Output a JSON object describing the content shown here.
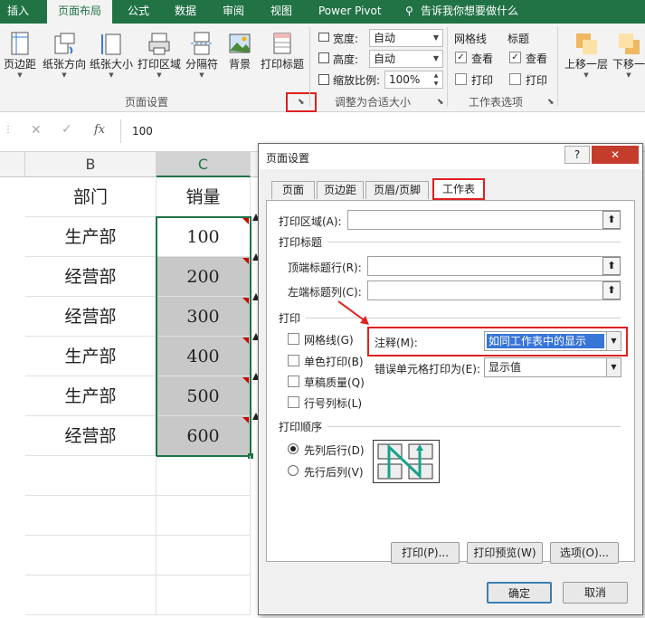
{
  "ribbon_tabs": [
    "插入",
    "页面布局",
    "公式",
    "数据",
    "审阅",
    "视图",
    "Power Pivot",
    "告诉我你想要做什么"
  ],
  "page_setup_group": {
    "buttons": [
      "页边距",
      "纸张方向",
      "纸张大小",
      "打印区域",
      "分隔符",
      "背景",
      "打印标题"
    ],
    "name": "页面设置"
  },
  "scale_group": {
    "width_label": "宽度:",
    "width_value": "自动",
    "height_label": "高度:",
    "height_value": "自动",
    "scale_label": "缩放比例:",
    "scale_value": "100%",
    "name": "调整为合适大小"
  },
  "sheet_options_group": {
    "gridlines": "网格线",
    "headings": "标题",
    "view": "查看",
    "print": "打印",
    "name": "工作表选项"
  },
  "arrange_group": {
    "bring_forward": "上移一层",
    "send_backward": "下移一"
  },
  "formula_bar": {
    "value": "100",
    "fx": "fx"
  },
  "columns": [
    "B",
    "C"
  ],
  "header_row": {
    "dept": "部门",
    "sales": "销量"
  },
  "rows": [
    {
      "dept": "生产部",
      "sales": "100"
    },
    {
      "dept": "经营部",
      "sales": "200"
    },
    {
      "dept": "经营部",
      "sales": "300"
    },
    {
      "dept": "生产部",
      "sales": "400"
    },
    {
      "dept": "生产部",
      "sales": "500"
    },
    {
      "dept": "经营部",
      "sales": "600"
    }
  ],
  "dialog": {
    "title": "页面设置",
    "tabs": [
      "页面",
      "页边距",
      "页眉/页脚",
      "工作表"
    ],
    "print_area": "打印区域(A):",
    "print_titles": "打印标题",
    "rows_repeat": "顶端标题行(R):",
    "cols_repeat": "左端标题列(C):",
    "print_section": "打印",
    "checkboxes": [
      "网格线(G)",
      "单色打印(B)",
      "草稿质量(Q)",
      "行号列标(L)"
    ],
    "comments_label": "注释(M):",
    "comments_value": "如同工作表中的显示",
    "errors_label": "错误单元格打印为(E):",
    "errors_value": "显示值",
    "order_section": "打印顺序",
    "order_down": "先列后行(D)",
    "order_over": "先行后列(V)",
    "print_btn": "打印(P)...",
    "preview_btn": "打印预览(W)",
    "options_btn": "选项(O)...",
    "ok": "确定",
    "cancel": "取消"
  }
}
